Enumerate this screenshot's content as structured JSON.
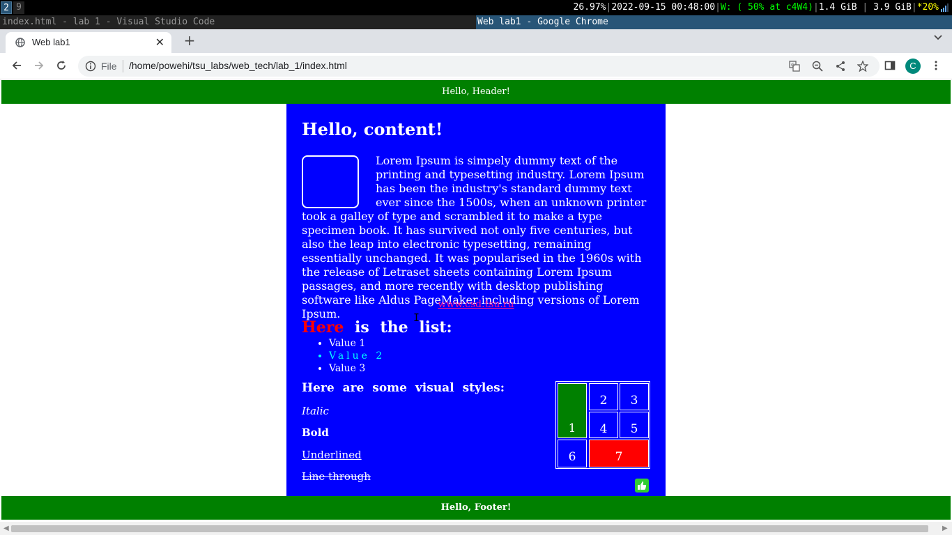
{
  "i3bar": {
    "workspaces": [
      "2",
      "9"
    ],
    "cpu": "26.97%",
    "datetime": "2022-09-15 00:48:00",
    "wifi": "W: ( 50% at c4W4)",
    "mem_used": "1.4 GiB",
    "mem_total": "3.9 GiB",
    "battery": "*20%"
  },
  "windows": {
    "left_title": "index.html - lab 1 - Visual Studio Code",
    "right_title": "Web lab1 - Google Chrome"
  },
  "browser": {
    "tab_title": "Web lab1",
    "address_scheme": "File",
    "address_path": "/home/powehi/tsu_labs/web_tech/lab_1/index.html",
    "profile_initial": "C",
    "icons": [
      "back-arrow-icon",
      "forward-arrow-icon",
      "reload-icon",
      "info-icon",
      "translate-icon",
      "zoom-out-icon",
      "share-icon",
      "star-icon",
      "side-panel-icon",
      "menu-kebab-icon"
    ]
  },
  "page": {
    "header": "Hello, Header!",
    "heading": "Hello, content!",
    "paragraph": "Lorem Ipsum is simpely dummy text of the printing and typesetting industry. Lorem Ipsum has been the industry's standard dummy text ever since the 1500s, when an unknown printer took a galley of type and scrambled it to make a type specimen book. It has survived not only five centuries, but also the leap into electronic typesetting, remaining essentially unchanged. It was popularised in the 1960s with the release of Letraset sheets containing Lorem Ipsum passages, and more recently with desktop publishing software like Aldus PageMaker including versions of Lorem Ipsum.",
    "link": "www.csd.tsu.ru",
    "list_heading_highlight": "Here",
    "list_heading_rest": "is the list:",
    "list_items": [
      "Value 1",
      "Value 2",
      "Value 3"
    ],
    "styles_heading": "Here are some visual styles:",
    "style_italic": "Italic",
    "style_bold": "Bold",
    "style_underline": "Underlined",
    "style_strike": "Line through",
    "table_cells": [
      "1",
      "2",
      "3",
      "4",
      "5",
      "6",
      "7"
    ],
    "footer": "Hello, Footer!"
  },
  "colors": {
    "content_bg": "#0000ff",
    "header_bg": "#008000",
    "highlight_red": "#ff0000",
    "link_pink": "#ff1493",
    "list_cyan": "#00ffff"
  }
}
